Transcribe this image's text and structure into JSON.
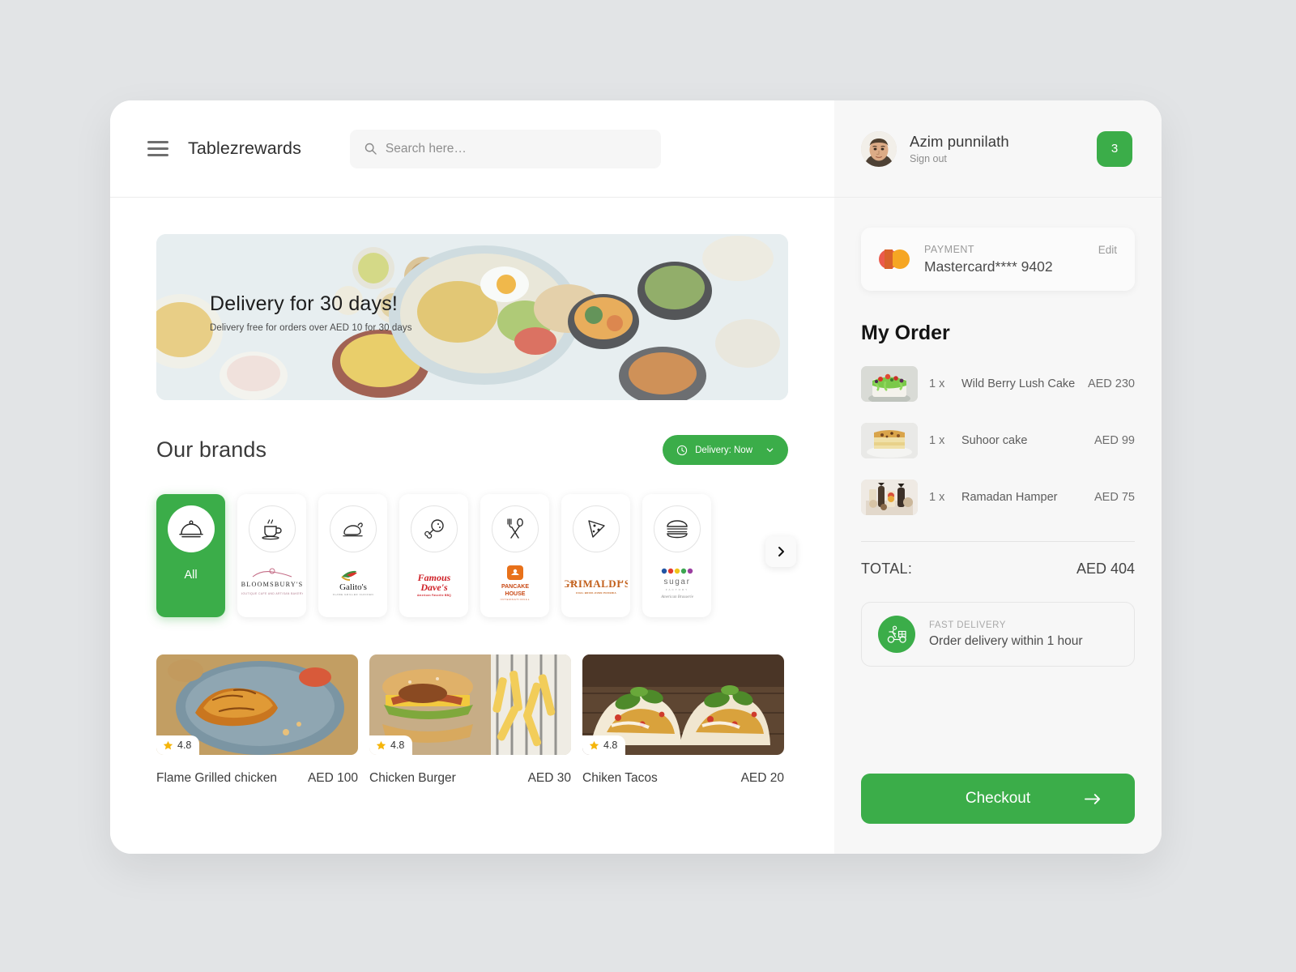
{
  "header": {
    "menu_icon": "hamburger-menu-icon",
    "brand_title": "Tablezrewards",
    "search": {
      "placeholder": "Search here…",
      "value": "",
      "icon": "search-icon"
    }
  },
  "user": {
    "name": "Azim punnilath",
    "sign_out": "Sign out",
    "cart_count": "3",
    "avatar": "user-avatar"
  },
  "banner": {
    "title": "Delivery for 30 days!",
    "subtitle": "Delivery free for orders over AED 10 for 30 days"
  },
  "brands_section": {
    "title": "Our brands",
    "delivery_pill": {
      "label": "Delivery: Now",
      "icon": "clock-icon",
      "chevron": "chevron-down-icon"
    },
    "next_arrow": "chevron-right-icon",
    "items": [
      {
        "label": "All",
        "icon": "cloche-icon",
        "active": true
      },
      {
        "label": "BLOOMSBURY'S",
        "sub": "BOUTIQUE CAFE AND ARTISAN BAKERY",
        "icon": "coffee-cup-icon",
        "active": false
      },
      {
        "label": "Galito's",
        "sub": "FLAME GRILLED CHICKEN",
        "icon": "roast-chicken-icon",
        "active": false
      },
      {
        "label": "Famous Dave's",
        "sub": "American Favorite BBQ",
        "icon": "drumstick-icon",
        "active": false
      },
      {
        "label": "PANCAKE HOUSE",
        "sub": "INTERNATIONAL",
        "icon": "fork-spoon-icon",
        "active": false
      },
      {
        "label": "GRIMALDI'S",
        "sub": "COAL BRICK-OVEN PIZZERIA",
        "icon": "pizza-slice-icon",
        "active": false
      },
      {
        "label": "sugar",
        "sub": "FACTORY · American Brasserie",
        "icon": "burger-icon",
        "active": false
      }
    ]
  },
  "foods": [
    {
      "name": "Flame Grilled chicken",
      "price": "AED 100",
      "rating": "4.8",
      "image": "grilled-chicken-plate"
    },
    {
      "name": "Chicken Burger",
      "price": "AED 30",
      "rating": "4.8",
      "image": "chicken-burger-fries"
    },
    {
      "name": "Chiken Tacos",
      "price": "AED 20",
      "rating": "4.8",
      "image": "fish-tacos"
    }
  ],
  "payment": {
    "label": "PAYMENT",
    "value": "Mastercard**** 9402",
    "edit": "Edit",
    "logo": "mastercard-logo"
  },
  "order": {
    "title": "My Order",
    "items": [
      {
        "qty": "1 x",
        "name": "Wild Berry Lush Cake",
        "price": "AED 230",
        "image": "green-berry-cake"
      },
      {
        "qty": "1 x",
        "name": "Suhoor cake",
        "price": "AED 99",
        "image": "suhoor-cake-slice"
      },
      {
        "qty": "1 x",
        "name": "Ramadan Hamper",
        "price": "AED 75",
        "image": "ramadan-hamper-basket"
      }
    ],
    "total_label": "TOTAL:",
    "total_value": "AED 404"
  },
  "fast_delivery": {
    "label": "FAST DELIVERY",
    "value": "Order delivery within 1 hour",
    "icon": "delivery-scooter-icon"
  },
  "checkout": {
    "label": "Checkout",
    "icon": "arrow-right-icon"
  },
  "colors": {
    "accent_green": "#3bad49",
    "page_bg": "#e2e4e6",
    "panel_bg": "#f7f7f7"
  }
}
